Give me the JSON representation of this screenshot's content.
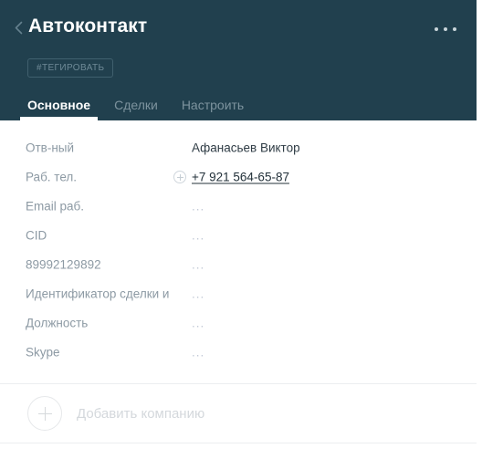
{
  "header": {
    "back_icon": "chevron-left-icon",
    "title": "Автоконтакт",
    "more_icon": "ellipsis-icon",
    "tag_button": "#ТЕГИРОВАТЬ",
    "background_color": "#21404e",
    "tabs": [
      {
        "label": "Основное",
        "active": true
      },
      {
        "label": "Сделки",
        "active": false
      },
      {
        "label": "Настроить",
        "active": false
      }
    ]
  },
  "fields": [
    {
      "label": "Отв-ный",
      "value": "Афанасьев Виктор",
      "empty": false,
      "link": false,
      "has_plus": false
    },
    {
      "label": "Раб. тел.",
      "value": "+7 921 564-65-87",
      "empty": false,
      "link": true,
      "has_plus": true
    },
    {
      "label": "Email раб.",
      "value": "...",
      "empty": true,
      "link": false,
      "has_plus": false
    },
    {
      "label": "CID",
      "value": "...",
      "empty": true,
      "link": false,
      "has_plus": false
    },
    {
      "label": "89992129892",
      "value": "...",
      "empty": true,
      "link": false,
      "has_plus": false
    },
    {
      "label": "Идентификатор сделки и",
      "value": "...",
      "empty": true,
      "link": false,
      "has_plus": false
    },
    {
      "label": "Должность",
      "value": "...",
      "empty": true,
      "link": false,
      "has_plus": false
    },
    {
      "label": "Skype",
      "value": "...",
      "empty": true,
      "link": false,
      "has_plus": false
    }
  ],
  "add_company": {
    "icon": "plus-circle-icon",
    "label": "Добавить компанию"
  },
  "colors": {
    "header_bg": "#21404e",
    "label": "#8d9aa4",
    "value": "#2f3c45",
    "placeholder": "#c2c9d6",
    "tab_inactive": "#7d939e",
    "divider": "#eceef0"
  }
}
